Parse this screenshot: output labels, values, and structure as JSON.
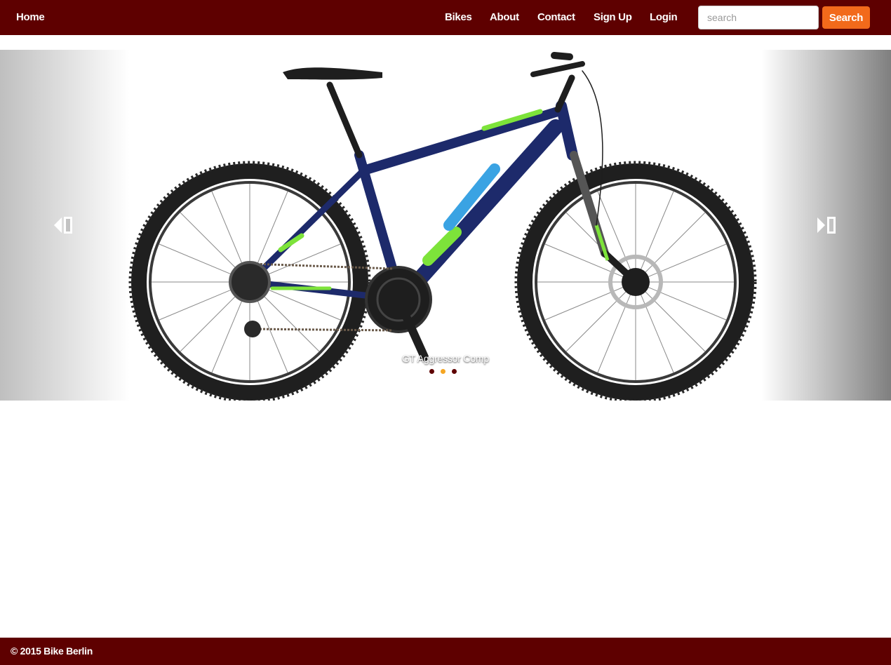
{
  "navbar": {
    "home_label": "Home",
    "links": [
      "Bikes",
      "About",
      "Contact",
      "Sign Up",
      "Login"
    ],
    "search_placeholder": "search",
    "search_button_label": "Search",
    "bg_color": "#5e0000",
    "button_color": "#f26a1b"
  },
  "carousel": {
    "caption": "GT Aggressor Comp",
    "indicator_count": 3,
    "active_index": 1,
    "indicator_colors": [
      "#5e0000",
      "#f5a623",
      "#5e0000"
    ],
    "prev_icon": "chevron-left-icon",
    "next_icon": "chevron-right-icon"
  },
  "footer": {
    "text": "© 2015 Bike Berlin"
  }
}
